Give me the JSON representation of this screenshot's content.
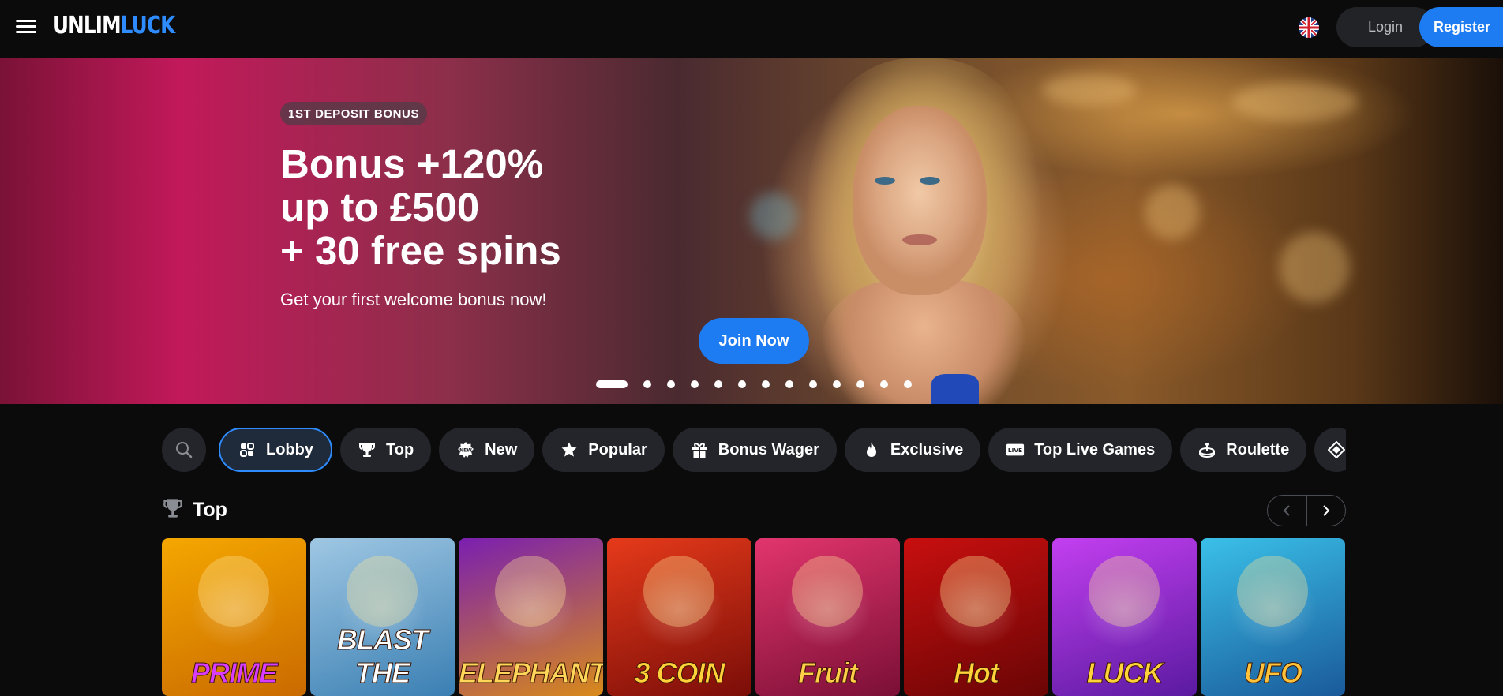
{
  "header": {
    "menu_icon": "hamburger-menu-icon",
    "logo_part1": "UNLIM",
    "logo_part2": "LUCK",
    "language_icon": "uk-flag-icon",
    "login_label": "Login",
    "register_label": "Register"
  },
  "hero": {
    "badge": "1ST DEPOSIT BONUS",
    "title_lines": [
      "Bonus +120%",
      "up to £500",
      "+ 30 free spins"
    ],
    "subtitle": "Get your first welcome bonus now!",
    "cta_label": "Join Now",
    "slides_total": 14,
    "active_slide": 1
  },
  "categories": {
    "search_icon": "search-icon",
    "items": [
      {
        "label": "Lobby",
        "icon": "lobby-icon",
        "active": true
      },
      {
        "label": "Top",
        "icon": "trophy-icon",
        "active": false
      },
      {
        "label": "New",
        "icon": "new-badge-icon",
        "active": false
      },
      {
        "label": "Popular",
        "icon": "star-icon",
        "active": false
      },
      {
        "label": "Bonus Wager",
        "icon": "gift-icon",
        "active": false
      },
      {
        "label": "Exclusive",
        "icon": "flame-icon",
        "active": false
      },
      {
        "label": "Top Live Games",
        "icon": "live-icon",
        "active": false
      },
      {
        "label": "Roulette",
        "icon": "roulette-icon",
        "active": false
      }
    ]
  },
  "section": {
    "title": "Top",
    "icon": "trophy-icon"
  },
  "games": [
    {
      "name": "PRIME",
      "colors": [
        "#f5a700",
        "#c96a00"
      ],
      "text_color": "#d83cff"
    },
    {
      "name": "BLAST THE",
      "colors": [
        "#9fc7e3",
        "#3a7fb3"
      ],
      "text_color": "#ffffff"
    },
    {
      "name": "ELEPHANT'S",
      "colors": [
        "#7a1fb0",
        "#d88a1a"
      ],
      "text_color": "#ffd65a"
    },
    {
      "name": "3 COIN",
      "colors": [
        "#e63a1a",
        "#7a0d08"
      ],
      "text_color": "#ffd23a"
    },
    {
      "name": "Fruit",
      "colors": [
        "#e2356d",
        "#7a0f35"
      ],
      "text_color": "#ffcf4a"
    },
    {
      "name": "Hot",
      "colors": [
        "#c80f0f",
        "#6a0505"
      ],
      "text_color": "#ffd23a"
    },
    {
      "name": "LUCK",
      "colors": [
        "#c33ff0",
        "#5a1aa0"
      ],
      "text_color": "#ffd23a"
    },
    {
      "name": "UFO",
      "colors": [
        "#3ac0e8",
        "#1a5a9a"
      ],
      "text_color": "#ffc23a"
    }
  ]
}
